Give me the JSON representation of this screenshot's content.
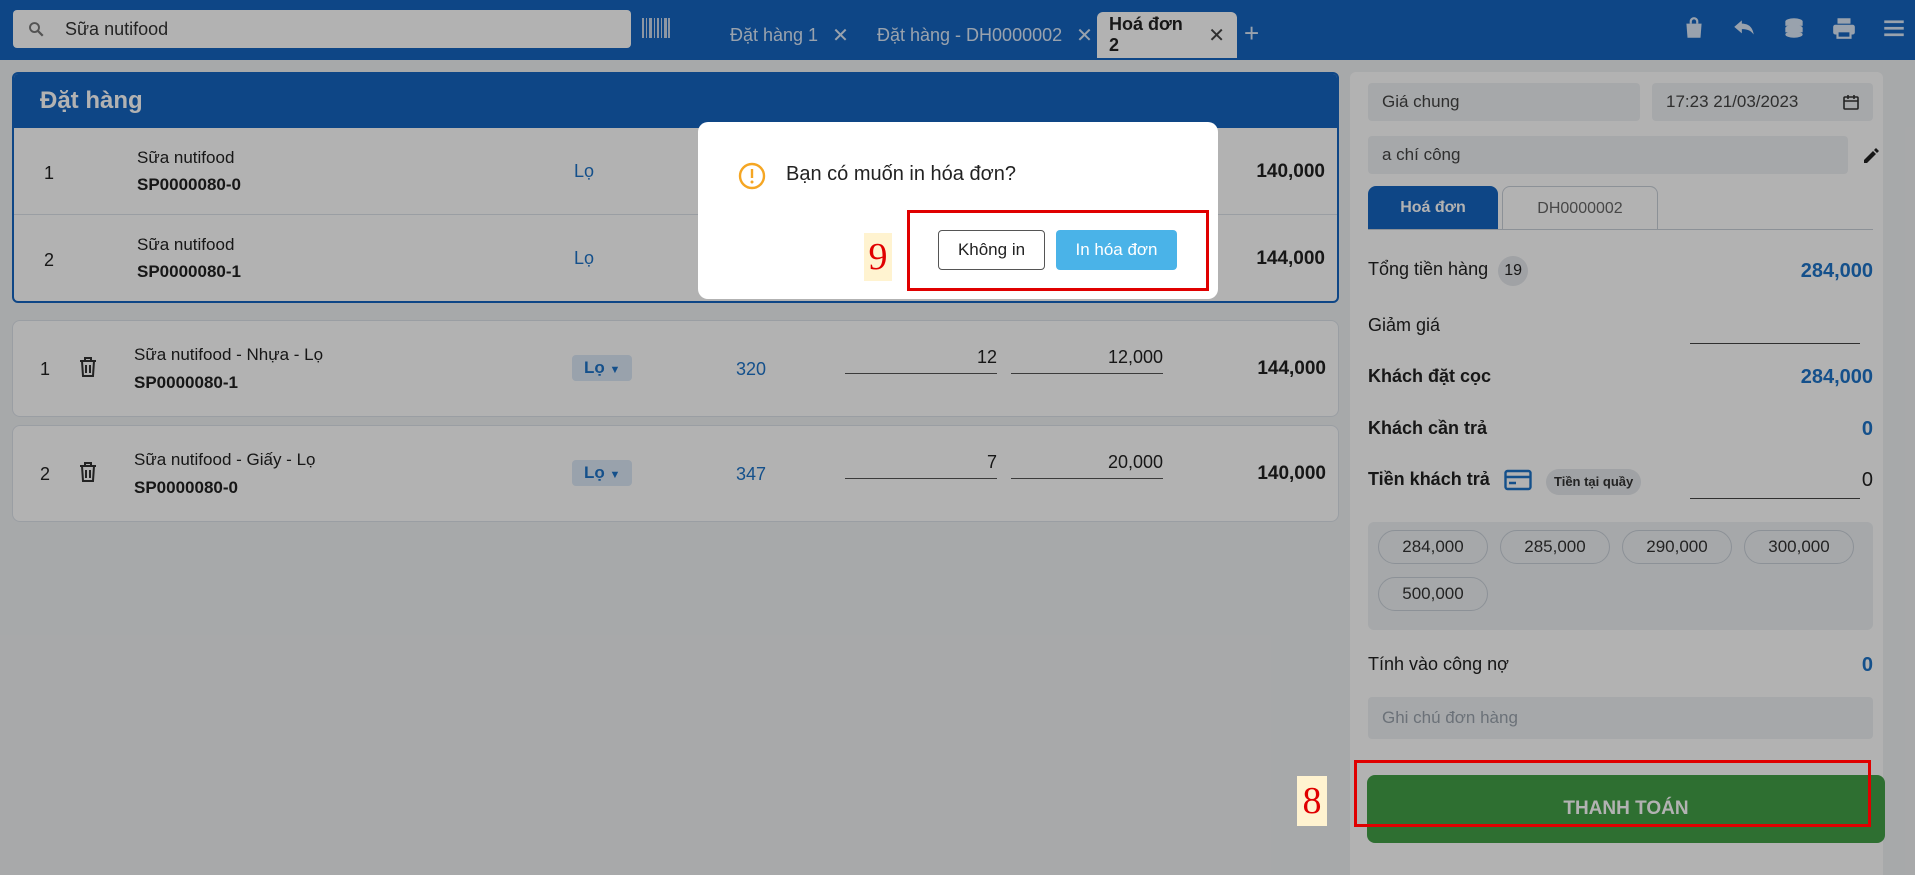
{
  "topbar": {
    "search_value": "Sữa nutifood",
    "tabs": [
      {
        "label": "Đặt hàng 1"
      },
      {
        "label": "Đặt hàng - DH0000002"
      },
      {
        "label": "Hoá đơn 2"
      }
    ],
    "close_glyph": "✕",
    "add_glyph": "+",
    "icons": [
      "search-icon",
      "barcode-icon",
      "bag-icon",
      "undo-icon",
      "coins-icon",
      "printer-icon",
      "menu-icon"
    ]
  },
  "order_panel": {
    "title": "Đặt hàng",
    "rows": [
      {
        "no": "1",
        "name": "Sữa nutifood",
        "code": "SP0000080-0",
        "unit": "Lọ",
        "total": "140,000"
      },
      {
        "no": "2",
        "name": "Sữa nutifood",
        "code": "SP0000080-1",
        "unit": "Lọ",
        "total": "144,000"
      }
    ]
  },
  "cart": [
    {
      "no": "1",
      "name": "Sữa nutifood - Nhựa - Lọ",
      "code": "SP0000080-1",
      "unit": "Lọ",
      "stock": "320",
      "qty": "12",
      "price": "12,000",
      "total": "144,000"
    },
    {
      "no": "2",
      "name": "Sữa nutifood - Giấy - Lọ",
      "code": "SP0000080-0",
      "unit": "Lọ",
      "stock": "347",
      "qty": "7",
      "price": "20,000",
      "total": "140,000"
    }
  ],
  "summary": {
    "price_list": "Giá chung",
    "datetime": "17:23 21/03/2023",
    "customer": "a chí công",
    "tabs": [
      "Hoá đơn",
      "DH0000002"
    ],
    "total_goods_label": "Tổng tiền hàng",
    "total_goods_count": "19",
    "total_goods_value": "284,000",
    "discount_label": "Giảm giá",
    "deposit_label": "Khách đặt cọc",
    "deposit_value": "284,000",
    "need_pay_label": "Khách cần trả",
    "need_pay_value": "0",
    "paid_label": "Tiền khách trả",
    "paid_method": "Tiền tại quầy",
    "paid_value": "0",
    "quick_amounts": [
      "284,000",
      "285,000",
      "290,000",
      "300,000",
      "500,000"
    ],
    "debt_label": "Tính vào công nợ",
    "debt_value": "0",
    "note_placeholder": "Ghi chú đơn hàng",
    "pay_label": "THANH TOÁN"
  },
  "dialog": {
    "question": "Bạn có muốn in hóa đơn?",
    "no_label": "Không in",
    "yes_label": "In hóa đơn"
  },
  "annotations": {
    "step8": "8",
    "step9": "9"
  },
  "colors": {
    "primary": "#1565c0",
    "link": "#1e73c8",
    "pay": "#43a047",
    "confirm": "#4ab3e8",
    "highlight": "#e00000"
  }
}
